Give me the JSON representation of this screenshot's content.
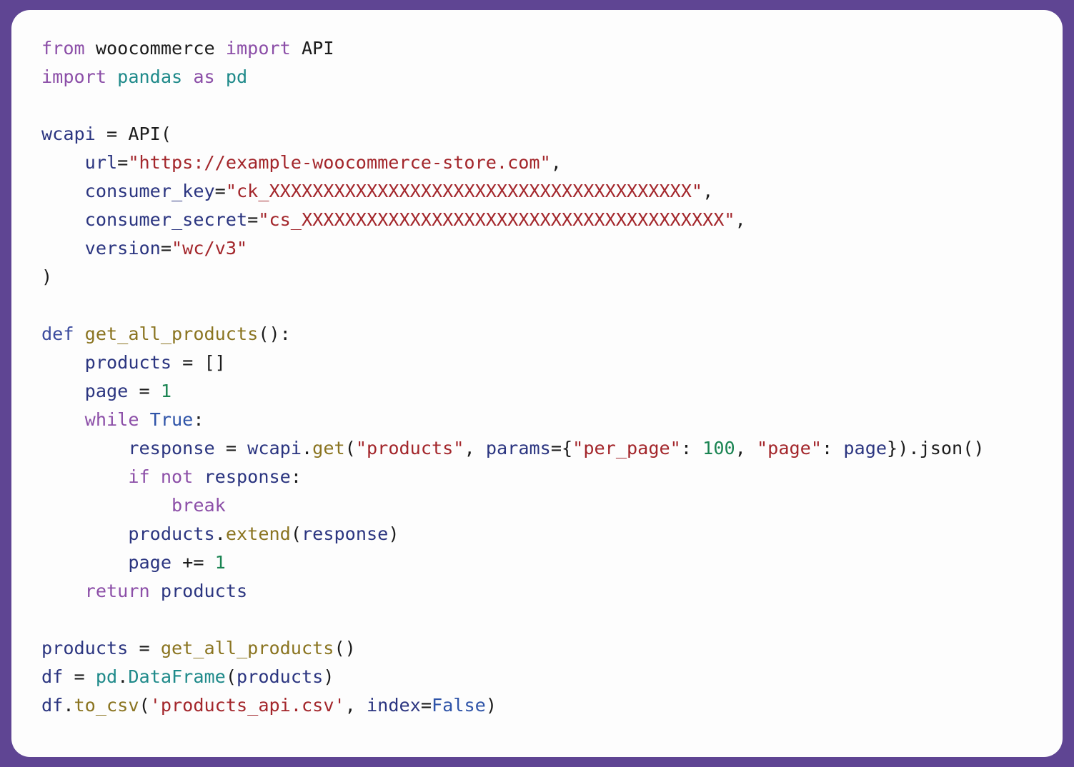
{
  "window": {
    "kind": "code-snippet-card",
    "language": "python",
    "border_color": "#5f4593",
    "card_background": "#fdfdfd"
  },
  "theme": {
    "keyword": "#8c4fa8",
    "def_keyword": "#3b4b9e",
    "builtin": "#2f54a8",
    "function": "#8a7420",
    "identifier": "#2b3580",
    "module": "#1f8a8a",
    "string": "#a3262b",
    "number": "#1a8452",
    "plain": "#1c1c1c"
  },
  "code": {
    "full_text": "from woocommerce import API\nimport pandas as pd\n\nwcapi = API(\n    url=\"https://example-woocommerce-store.com\",\n    consumer_key=\"ck_XXXXXXXXXXXXXXXXXXXXXXXXXXXXXXXXXXXXXXX\",\n    consumer_secret=\"cs_XXXXXXXXXXXXXXXXXXXXXXXXXXXXXXXXXXXXXXX\",\n    version=\"wc/v3\"\n)\n\ndef get_all_products():\n    products = []\n    page = 1\n    while True:\n        response = wcapi.get(\"products\", params={\"per_page\": 100, \"page\": page}).json()\n        if not response:\n            break\n        products.extend(response)\n        page += 1\n    return products\n\nproducts = get_all_products()\ndf = pd.DataFrame(products)\ndf.to_csv('products_api.csv', index=False)",
    "lines": [
      {
        "n": 1,
        "text": "from woocommerce import API",
        "tokens": [
          {
            "t": "from",
            "c": "kw"
          },
          {
            "t": " ",
            "c": "plain"
          },
          {
            "t": "woocommerce",
            "c": "plain"
          },
          {
            "t": " ",
            "c": "plain"
          },
          {
            "t": "import",
            "c": "kw"
          },
          {
            "t": " ",
            "c": "plain"
          },
          {
            "t": "API",
            "c": "plain"
          }
        ]
      },
      {
        "n": 2,
        "text": "import pandas as pd",
        "tokens": [
          {
            "t": "import",
            "c": "kw"
          },
          {
            "t": " ",
            "c": "plain"
          },
          {
            "t": "pandas",
            "c": "mod"
          },
          {
            "t": " ",
            "c": "plain"
          },
          {
            "t": "as",
            "c": "kw"
          },
          {
            "t": " ",
            "c": "plain"
          },
          {
            "t": "pd",
            "c": "mod"
          }
        ]
      },
      {
        "n": 3,
        "text": "",
        "tokens": []
      },
      {
        "n": 4,
        "text": "wcapi = API(",
        "tokens": [
          {
            "t": "wcapi",
            "c": "name"
          },
          {
            "t": " = ",
            "c": "plain"
          },
          {
            "t": "API(",
            "c": "plain"
          }
        ]
      },
      {
        "n": 5,
        "text": "    url=\"https://example-woocommerce-store.com\",",
        "tokens": [
          {
            "t": "    ",
            "c": "plain"
          },
          {
            "t": "url",
            "c": "name"
          },
          {
            "t": "=",
            "c": "plain"
          },
          {
            "t": "\"https://example-woocommerce-store.com\"",
            "c": "str"
          },
          {
            "t": ",",
            "c": "plain"
          }
        ]
      },
      {
        "n": 6,
        "text": "    consumer_key=\"ck_XXXXXXXXXXXXXXXXXXXXXXXXXXXXXXXXXXXXXXX\",",
        "tokens": [
          {
            "t": "    ",
            "c": "plain"
          },
          {
            "t": "consumer_key",
            "c": "name"
          },
          {
            "t": "=",
            "c": "plain"
          },
          {
            "t": "\"ck_XXXXXXXXXXXXXXXXXXXXXXXXXXXXXXXXXXXXXXX\"",
            "c": "str"
          },
          {
            "t": ",",
            "c": "plain"
          }
        ]
      },
      {
        "n": 7,
        "text": "    consumer_secret=\"cs_XXXXXXXXXXXXXXXXXXXXXXXXXXXXXXXXXXXXXXX\",",
        "tokens": [
          {
            "t": "    ",
            "c": "plain"
          },
          {
            "t": "consumer_secret",
            "c": "name"
          },
          {
            "t": "=",
            "c": "plain"
          },
          {
            "t": "\"cs_XXXXXXXXXXXXXXXXXXXXXXXXXXXXXXXXXXXXXXX\"",
            "c": "str"
          },
          {
            "t": ",",
            "c": "plain"
          }
        ]
      },
      {
        "n": 8,
        "text": "    version=\"wc/v3\"",
        "tokens": [
          {
            "t": "    ",
            "c": "plain"
          },
          {
            "t": "version",
            "c": "name"
          },
          {
            "t": "=",
            "c": "plain"
          },
          {
            "t": "\"wc/v3\"",
            "c": "str"
          }
        ]
      },
      {
        "n": 9,
        "text": ")",
        "tokens": [
          {
            "t": ")",
            "c": "plain"
          }
        ]
      },
      {
        "n": 10,
        "text": "",
        "tokens": []
      },
      {
        "n": 11,
        "text": "def get_all_products():",
        "tokens": [
          {
            "t": "def",
            "c": "kw2"
          },
          {
            "t": " ",
            "c": "plain"
          },
          {
            "t": "get_all_products",
            "c": "fn"
          },
          {
            "t": "():",
            "c": "plain"
          }
        ]
      },
      {
        "n": 12,
        "text": "    products = []",
        "tokens": [
          {
            "t": "    ",
            "c": "plain"
          },
          {
            "t": "products",
            "c": "name"
          },
          {
            "t": " = []",
            "c": "plain"
          }
        ]
      },
      {
        "n": 13,
        "text": "    page = 1",
        "tokens": [
          {
            "t": "    ",
            "c": "plain"
          },
          {
            "t": "page",
            "c": "name"
          },
          {
            "t": " = ",
            "c": "plain"
          },
          {
            "t": "1",
            "c": "num"
          }
        ]
      },
      {
        "n": 14,
        "text": "    while True:",
        "tokens": [
          {
            "t": "    ",
            "c": "plain"
          },
          {
            "t": "while",
            "c": "kw"
          },
          {
            "t": " ",
            "c": "plain"
          },
          {
            "t": "True",
            "c": "bi"
          },
          {
            "t": ":",
            "c": "plain"
          }
        ]
      },
      {
        "n": 15,
        "text": "        response = wcapi.get(\"products\", params={\"per_page\": 100, \"page\": page}).json()",
        "tokens": [
          {
            "t": "        ",
            "c": "plain"
          },
          {
            "t": "response",
            "c": "name"
          },
          {
            "t": " = ",
            "c": "plain"
          },
          {
            "t": "wcapi",
            "c": "name"
          },
          {
            "t": ".",
            "c": "plain"
          },
          {
            "t": "get",
            "c": "fn"
          },
          {
            "t": "(",
            "c": "plain"
          },
          {
            "t": "\"products\"",
            "c": "str"
          },
          {
            "t": ", ",
            "c": "plain"
          },
          {
            "t": "params",
            "c": "name"
          },
          {
            "t": "={",
            "c": "plain"
          },
          {
            "t": "\"per_page\"",
            "c": "str"
          },
          {
            "t": ": ",
            "c": "plain"
          },
          {
            "t": "100",
            "c": "num"
          },
          {
            "t": ", ",
            "c": "plain"
          },
          {
            "t": "\"page\"",
            "c": "str"
          },
          {
            "t": ": ",
            "c": "plain"
          },
          {
            "t": "page",
            "c": "name"
          },
          {
            "t": "}).",
            "c": "plain"
          },
          {
            "t": "json()",
            "c": "plain"
          }
        ]
      },
      {
        "n": 16,
        "text": "        if not response:",
        "tokens": [
          {
            "t": "        ",
            "c": "plain"
          },
          {
            "t": "if",
            "c": "kw"
          },
          {
            "t": " ",
            "c": "plain"
          },
          {
            "t": "not",
            "c": "kw"
          },
          {
            "t": " ",
            "c": "plain"
          },
          {
            "t": "response",
            "c": "name"
          },
          {
            "t": ":",
            "c": "plain"
          }
        ]
      },
      {
        "n": 17,
        "text": "            break",
        "tokens": [
          {
            "t": "            ",
            "c": "plain"
          },
          {
            "t": "break",
            "c": "kw"
          }
        ]
      },
      {
        "n": 18,
        "text": "        products.extend(response)",
        "tokens": [
          {
            "t": "        ",
            "c": "plain"
          },
          {
            "t": "products",
            "c": "name"
          },
          {
            "t": ".",
            "c": "plain"
          },
          {
            "t": "extend",
            "c": "fn"
          },
          {
            "t": "(",
            "c": "plain"
          },
          {
            "t": "response",
            "c": "name"
          },
          {
            "t": ")",
            "c": "plain"
          }
        ]
      },
      {
        "n": 19,
        "text": "        page += 1",
        "tokens": [
          {
            "t": "        ",
            "c": "plain"
          },
          {
            "t": "page",
            "c": "name"
          },
          {
            "t": " += ",
            "c": "plain"
          },
          {
            "t": "1",
            "c": "num"
          }
        ]
      },
      {
        "n": 20,
        "text": "    return products",
        "tokens": [
          {
            "t": "    ",
            "c": "plain"
          },
          {
            "t": "return",
            "c": "kw"
          },
          {
            "t": " ",
            "c": "plain"
          },
          {
            "t": "products",
            "c": "name"
          }
        ]
      },
      {
        "n": 21,
        "text": "",
        "tokens": []
      },
      {
        "n": 22,
        "text": "products = get_all_products()",
        "tokens": [
          {
            "t": "products",
            "c": "name"
          },
          {
            "t": " = ",
            "c": "plain"
          },
          {
            "t": "get_all_products",
            "c": "fn"
          },
          {
            "t": "()",
            "c": "plain"
          }
        ]
      },
      {
        "n": 23,
        "text": "df = pd.DataFrame(products)",
        "tokens": [
          {
            "t": "df",
            "c": "name"
          },
          {
            "t": " = ",
            "c": "plain"
          },
          {
            "t": "pd",
            "c": "mod"
          },
          {
            "t": ".",
            "c": "plain"
          },
          {
            "t": "DataFrame",
            "c": "mod"
          },
          {
            "t": "(",
            "c": "plain"
          },
          {
            "t": "products",
            "c": "name"
          },
          {
            "t": ")",
            "c": "plain"
          }
        ]
      },
      {
        "n": 24,
        "text": "df.to_csv('products_api.csv', index=False)",
        "tokens": [
          {
            "t": "df",
            "c": "name"
          },
          {
            "t": ".",
            "c": "plain"
          },
          {
            "t": "to_csv",
            "c": "fn"
          },
          {
            "t": "(",
            "c": "plain"
          },
          {
            "t": "'products_api.csv'",
            "c": "str"
          },
          {
            "t": ", ",
            "c": "plain"
          },
          {
            "t": "index",
            "c": "name"
          },
          {
            "t": "=",
            "c": "plain"
          },
          {
            "t": "False",
            "c": "bi"
          },
          {
            "t": ")",
            "c": "plain"
          }
        ]
      }
    ]
  }
}
